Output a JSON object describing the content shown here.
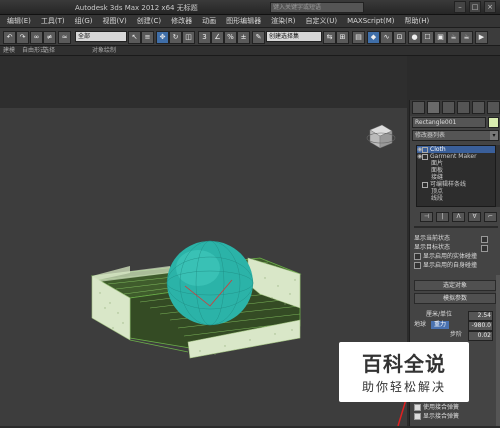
{
  "window": {
    "title": "Autodesk 3ds Max  2012 x64      无标题",
    "search_placeholder": "键入关键字或短语"
  },
  "menu": [
    "编辑(E)",
    "工具(T)",
    "组(G)",
    "视图(V)",
    "创建(C)",
    "修改器",
    "动画",
    "图形编辑器",
    "渲染(R)",
    "自定义(U)",
    "MAXScript(M)",
    "帮助(H)"
  ],
  "toolbar": {
    "selection_filter": "全部",
    "named_selection": "创建选择集"
  },
  "ribbon": {
    "tabs": [
      "建模",
      "自由形式",
      "选择",
      "对象绘制"
    ]
  },
  "command_panel": {
    "object_name": "Rectangle001",
    "object_color": "#d9ecb0",
    "modifier_list": "修改器列表",
    "stack": [
      {
        "label": "Cloth",
        "selected": true,
        "level": 0
      },
      {
        "label": "Garment Maker",
        "selected": false,
        "level": 0
      },
      {
        "label": "面片",
        "selected": false,
        "level": 1
      },
      {
        "label": "面板",
        "selected": false,
        "level": 1
      },
      {
        "label": "接缝",
        "selected": false,
        "level": 1
      },
      {
        "label": "可编辑样条线",
        "selected": false,
        "level": 0
      },
      {
        "label": "顶点",
        "selected": false,
        "level": 1
      },
      {
        "label": "线段",
        "selected": false,
        "level": 1
      }
    ],
    "stack_buttons": [
      "⊣",
      "|",
      "Ʌ",
      "∀",
      "⌐"
    ],
    "display_options": [
      {
        "label": "显示当前状态",
        "checked": false
      },
      {
        "label": "显示目标状态",
        "checked": false
      },
      {
        "label": "显示启用的实体碰撞",
        "checked": false
      },
      {
        "label": "显示启用的自身碰撞",
        "checked": false
      }
    ],
    "rollout_selected_objects": "选定对象",
    "rollout_simulation_params": "模拟参数",
    "spinners": [
      {
        "label": "厘米/单位",
        "value": "2.54"
      },
      {
        "label": "地球",
        "button": "重力",
        "value": "-980.0"
      },
      {
        "label": "步阶",
        "value": "0.02"
      }
    ],
    "bottom_options": [
      {
        "label": "使用接合弹簧",
        "checked": true
      },
      {
        "label": "显示接合弹簧",
        "checked": true
      }
    ]
  },
  "scene": {
    "sphere_color": "#2bb3a8",
    "box_color": "#d9e7c8",
    "wire_color": "#5c9c3a"
  },
  "watermark": {
    "title": "百科全说",
    "subtitle": "助你轻松解决"
  }
}
